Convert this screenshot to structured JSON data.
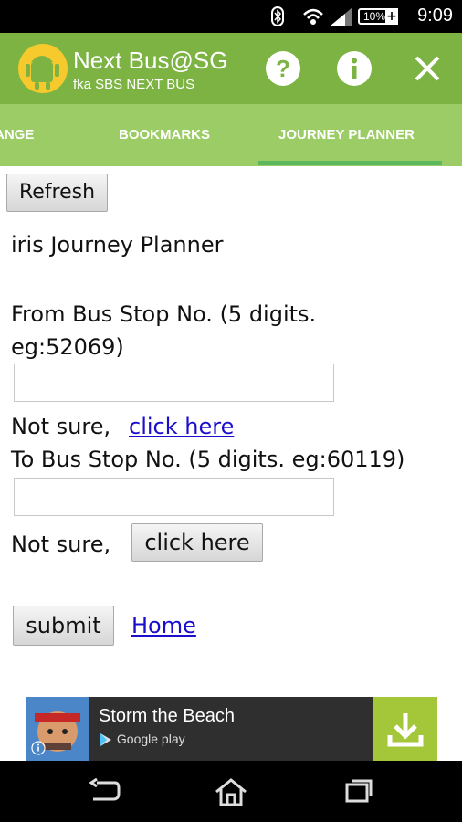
{
  "status": {
    "time": "9:09",
    "battery_pct": "10%"
  },
  "app": {
    "title": "Next Bus@SG",
    "subtitle": "fka SBS NEXT BUS"
  },
  "tabs": [
    {
      "label": "ANGE"
    },
    {
      "label": "BOOKMARKS"
    },
    {
      "label": "JOURNEY PLANNER",
      "selected": true
    }
  ],
  "page": {
    "refresh": "Refresh",
    "heading": "iris Journey Planner",
    "from_label_line1": "From Bus Stop No. (5 digits.",
    "from_label_line2": "eg:52069)",
    "from_value": "",
    "not_sure_1": "Not sure,",
    "click_here_link": "click here",
    "to_label": "To Bus Stop No. (5 digits. eg:60119)",
    "to_value": "",
    "not_sure_2": "Not sure,",
    "click_here_button": "click here",
    "submit": "submit",
    "home": "Home"
  },
  "ad": {
    "title": "Storm the Beach",
    "store": "Google play"
  },
  "colors": {
    "appbar": "#7cb342",
    "tabbar": "#9ccc65",
    "indicator": "#5cb85c",
    "link": "#1a0dcc",
    "ad_download": "#a4c639"
  }
}
